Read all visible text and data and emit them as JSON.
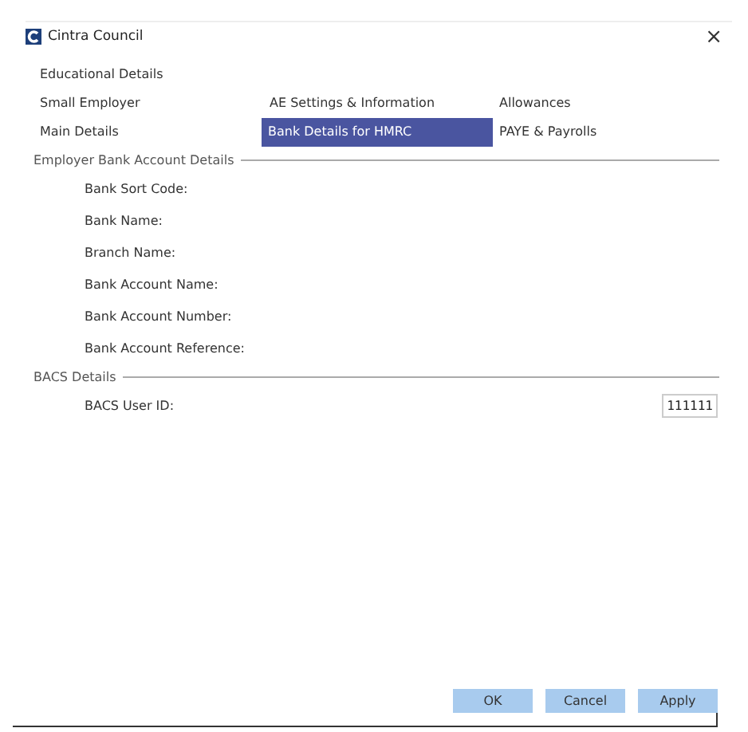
{
  "window": {
    "title": "Cintra Council",
    "close": "×"
  },
  "tab_rows": [
    [
      {
        "label": "Educational Details",
        "selected": false
      }
    ],
    [
      {
        "label": "Small Employer",
        "selected": false
      },
      {
        "label": "AE Settings & Information",
        "selected": false
      },
      {
        "label": "Allowances",
        "selected": false
      }
    ],
    [
      {
        "label": "Main Details",
        "selected": false
      },
      {
        "label": "Bank Details for HMRC",
        "selected": true
      },
      {
        "label": "PAYE & Payrolls",
        "selected": false
      }
    ]
  ],
  "sections": [
    {
      "title": "Employer Bank Account Details",
      "fields": [
        {
          "label": "Bank Sort Code:"
        },
        {
          "label": "Bank Name:"
        },
        {
          "label": "Branch Name:"
        },
        {
          "label": "Bank Account Name:"
        },
        {
          "label": "Bank Account Number:"
        },
        {
          "label": "Bank Account Reference:"
        }
      ]
    },
    {
      "title": "BACS Details",
      "fields": [
        {
          "label": "BACS User ID:",
          "value": "111111"
        }
      ]
    }
  ],
  "buttons": [
    "OK",
    "Cancel",
    "Apply"
  ]
}
